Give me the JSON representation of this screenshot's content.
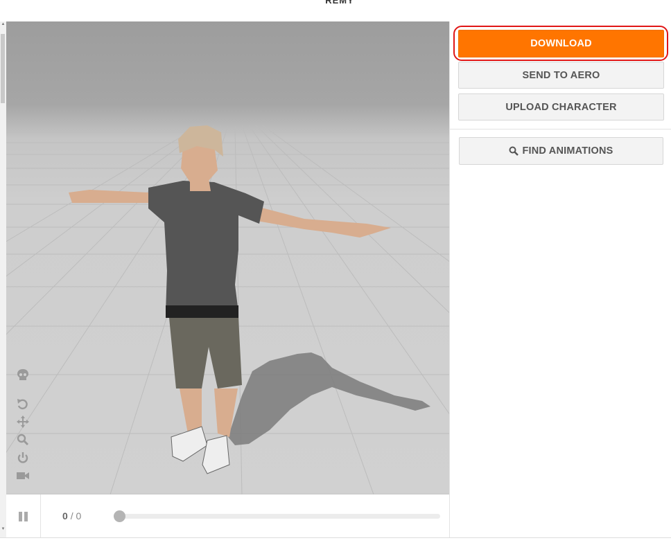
{
  "page": {
    "title": "REMY"
  },
  "viewer": {
    "tools": [
      {
        "name": "skeleton-icon"
      },
      {
        "name": "reset-rotate-icon"
      },
      {
        "name": "pan-move-icon"
      },
      {
        "name": "zoom-icon"
      },
      {
        "name": "power-icon"
      },
      {
        "name": "camera-icon"
      }
    ]
  },
  "playback": {
    "state": "paused",
    "current_frame": "0",
    "separator": "/",
    "total_frames": "0",
    "progress": 0
  },
  "actions": {
    "download": "DOWNLOAD",
    "send_to_aero": "SEND TO AERO",
    "upload_character": "UPLOAD CHARACTER",
    "find_animations": "FIND ANIMATIONS"
  },
  "colors": {
    "download_bg": "#ff7500",
    "highlight_ring": "#e01515",
    "viewport_floor": "#d1d1d1"
  }
}
